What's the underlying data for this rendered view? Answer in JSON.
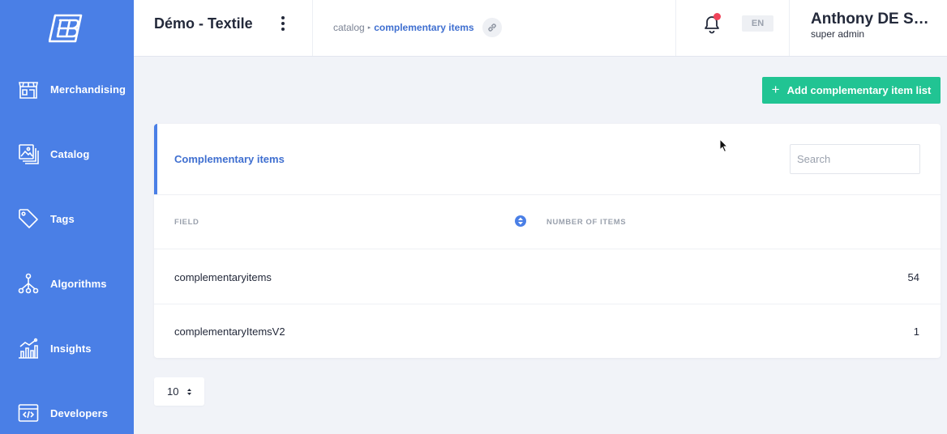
{
  "brand": {
    "logo_text": "EB",
    "primary_color": "#4a7fe6",
    "accent_color": "#21c493"
  },
  "sidebar": {
    "items": [
      {
        "label": "Merchandising",
        "icon": "storefront-icon"
      },
      {
        "label": "Catalog",
        "icon": "catalog-images-icon"
      },
      {
        "label": "Tags",
        "icon": "tag-icon"
      },
      {
        "label": "Algorithms",
        "icon": "algorithm-tree-icon"
      },
      {
        "label": "Insights",
        "icon": "chart-icon"
      },
      {
        "label": "Developers",
        "icon": "code-icon"
      }
    ]
  },
  "header": {
    "shop_title": "Démo - Textile",
    "breadcrumb": {
      "parent": "catalog",
      "current": "complementary items"
    },
    "language": "EN",
    "user": {
      "name": "Anthony DE SOUZA",
      "role": "super admin"
    }
  },
  "main": {
    "add_button_label": "Add complementary item list",
    "card": {
      "title": "Complementary items",
      "search_placeholder": "Search",
      "columns": {
        "field": "FIELD",
        "count": "NUMBER OF ITEMS"
      },
      "rows": [
        {
          "field": "complementaryitems",
          "count": "54"
        },
        {
          "field": "complementaryItemsV2",
          "count": "1"
        }
      ]
    },
    "page_size": "10"
  }
}
